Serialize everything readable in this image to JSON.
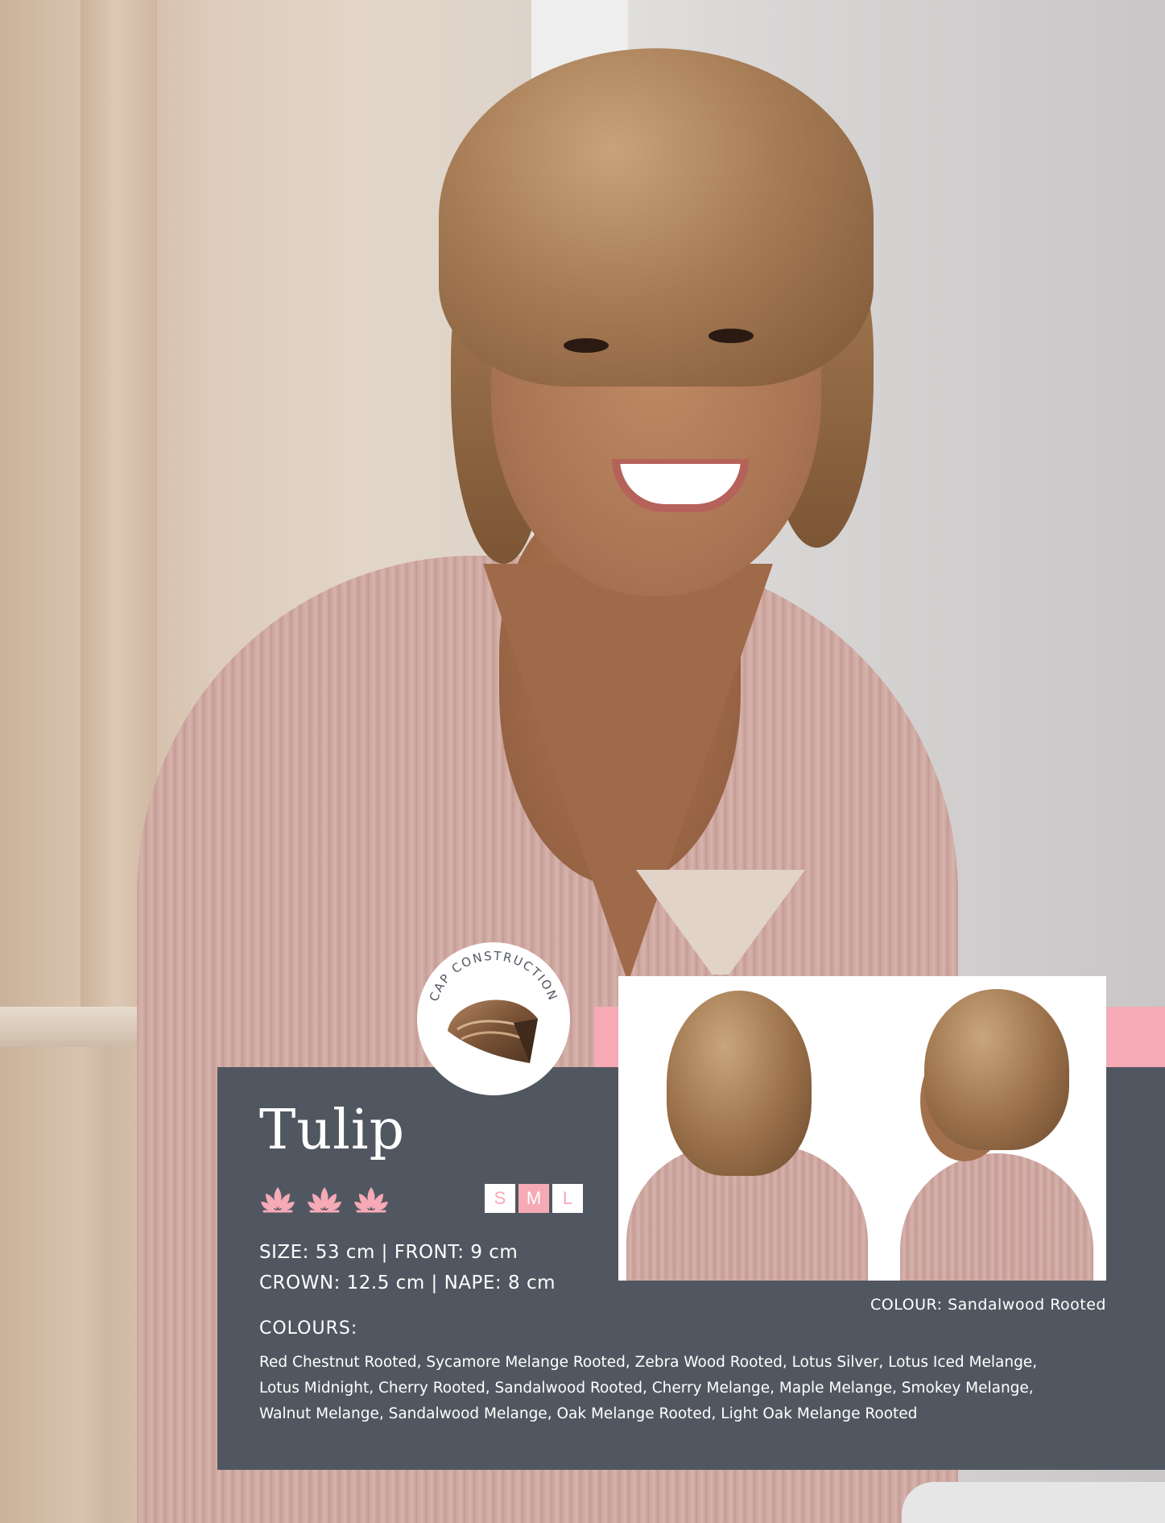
{
  "product": {
    "name": "Tulip",
    "rating_icon": "lotus-icon",
    "rating_count": 3,
    "sizes": [
      {
        "label": "S",
        "active": false
      },
      {
        "label": "M",
        "active": true
      },
      {
        "label": "L",
        "active": false
      }
    ],
    "spec_line_1": "SIZE: 53 cm | FRONT: 9 cm",
    "spec_line_2": "CROWN: 12.5 cm | NAPE: 8 cm",
    "colours_label": "COLOURS:",
    "colours_lines": [
      "Red Chestnut Rooted, Sycamore Melange Rooted, Zebra Wood Rooted, Lotus Silver, Lotus Iced Melange,",
      "Lotus Midnight, Cherry Rooted, Sandalwood Rooted, Cherry Melange, Maple Melange, Smokey Melange,",
      "Walnut Melange, Sandalwood Melange, Oak Melange Rooted, Light Oak Melange Rooted"
    ],
    "photo_caption": "COLOUR: Sandalwood Rooted"
  },
  "cap_badge": {
    "label": "CAP CONSTRUCTION",
    "icon": "wig-cap-icon"
  },
  "colors": {
    "panel": "#515760",
    "accent_pink": "#f5aab6",
    "text": "#ffffff"
  }
}
